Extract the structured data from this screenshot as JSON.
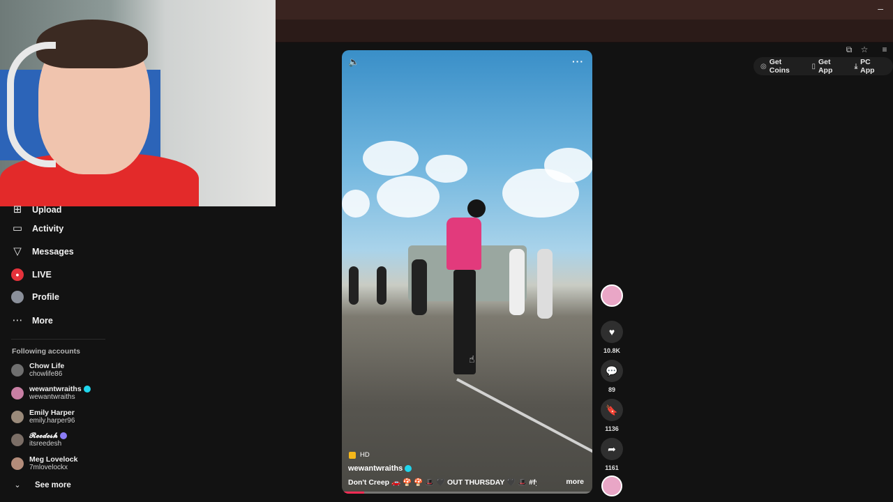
{
  "browser": {
    "minimize_glyph": "–"
  },
  "top_actions": [
    {
      "label": "Get Coins",
      "icon": "coin-icon"
    },
    {
      "label": "Get App",
      "icon": "phone-icon"
    },
    {
      "label": "PC App",
      "icon": "download-icon"
    }
  ],
  "sidebar": {
    "items": [
      {
        "label": "Upload",
        "icon": "upload-icon"
      },
      {
        "label": "Activity",
        "icon": "activity-icon"
      },
      {
        "label": "Messages",
        "icon": "messages-icon"
      },
      {
        "label": "LIVE",
        "icon": "live-icon"
      },
      {
        "label": "Profile",
        "icon": "avatar"
      },
      {
        "label": "More",
        "icon": "more-icon"
      }
    ],
    "following_title": "Following accounts",
    "accounts": [
      {
        "name": "Chow Life",
        "handle": "chowlife86",
        "verified": false
      },
      {
        "name": "wewantwraiths",
        "handle": "wewantwraiths",
        "verified": true
      },
      {
        "name": "Emily Harper",
        "handle": "emily.harper96",
        "verified": false
      },
      {
        "name": "𝓡𝓮𝓮𝓭𝓮𝓼𝓱",
        "handle": "itsreedesh",
        "verified": true
      },
      {
        "name": "Meg Lovelock",
        "handle": "7mlovelockx",
        "verified": false
      }
    ],
    "see_more": "See more"
  },
  "video": {
    "quality": "HD",
    "author": "wewantwraiths",
    "caption": "Don't Creep 🚗 🍄 🍄 🎩 🖤 OUT THURSDAY 🖤 🎩 #fyp ...",
    "more_label": "more",
    "progress_fraction": 0.09
  },
  "actions": {
    "likes": "10.8K",
    "comments": "89",
    "saves": "1136",
    "shares": "1161"
  }
}
